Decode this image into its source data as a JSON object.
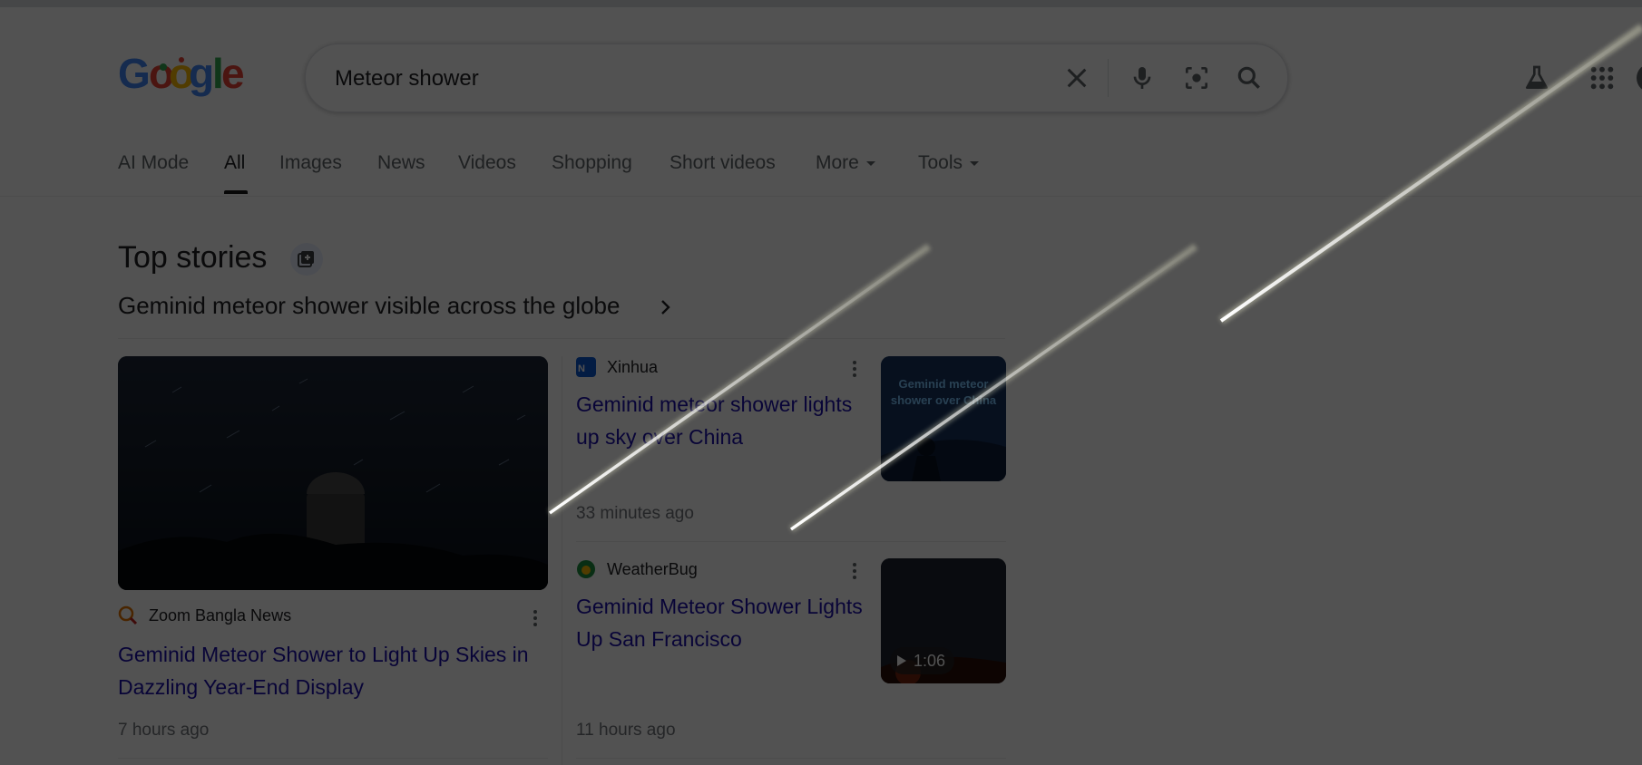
{
  "search": {
    "query": "Meteor shower"
  },
  "header": {
    "logo_text": "Google",
    "icons": [
      "close-icon",
      "microphone-icon",
      "lens-camera-icon",
      "search-icon",
      "labs-flask-icon",
      "apps-grid-icon"
    ]
  },
  "tabs": [
    {
      "label": "AI Mode"
    },
    {
      "label": "All"
    },
    {
      "label": "Images"
    },
    {
      "label": "News"
    },
    {
      "label": "Videos"
    },
    {
      "label": "Shopping"
    },
    {
      "label": "Short videos"
    },
    {
      "label": "More"
    },
    {
      "label": "Tools"
    }
  ],
  "top_stories": {
    "title": "Top stories",
    "headline": "Geminid meteor shower visible across the globe",
    "stories": [
      {
        "source": "Zoom Bangla News",
        "title": "Geminid Meteor Shower to Light Up Skies in Dazzling Year-End Display",
        "time": "7 hours ago"
      },
      {
        "source": "Xinhua",
        "title": "Geminid meteor shower lights up sky over China",
        "time": "33 minutes ago",
        "thumb_caption": "Geminid meteor shower over China"
      },
      {
        "source": "WeatherBug",
        "title": "Geminid Meteor Shower Lights Up San Francisco",
        "time": "11 hours ago",
        "video_duration": "1:06"
      }
    ]
  },
  "colors": {
    "link": "#1a0dab",
    "overlay": "#000000",
    "meteor": "#f2f2dc"
  }
}
